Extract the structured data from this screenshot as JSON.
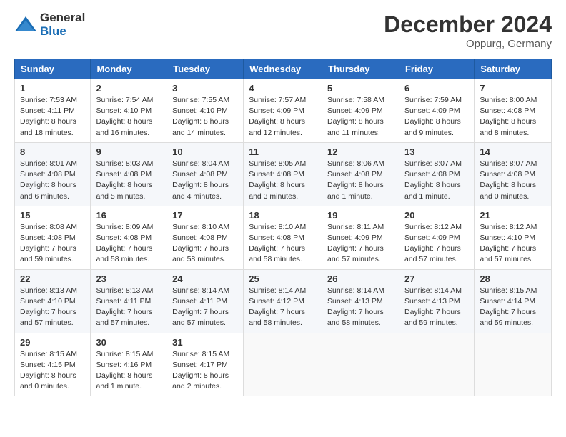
{
  "header": {
    "logo_general": "General",
    "logo_blue": "Blue",
    "month_title": "December 2024",
    "location": "Oppurg, Germany"
  },
  "days_of_week": [
    "Sunday",
    "Monday",
    "Tuesday",
    "Wednesday",
    "Thursday",
    "Friday",
    "Saturday"
  ],
  "weeks": [
    [
      {
        "day": "1",
        "sunrise": "7:53 AM",
        "sunset": "4:11 PM",
        "daylight": "8 hours and 18 minutes."
      },
      {
        "day": "2",
        "sunrise": "7:54 AM",
        "sunset": "4:10 PM",
        "daylight": "8 hours and 16 minutes."
      },
      {
        "day": "3",
        "sunrise": "7:55 AM",
        "sunset": "4:10 PM",
        "daylight": "8 hours and 14 minutes."
      },
      {
        "day": "4",
        "sunrise": "7:57 AM",
        "sunset": "4:09 PM",
        "daylight": "8 hours and 12 minutes."
      },
      {
        "day": "5",
        "sunrise": "7:58 AM",
        "sunset": "4:09 PM",
        "daylight": "8 hours and 11 minutes."
      },
      {
        "day": "6",
        "sunrise": "7:59 AM",
        "sunset": "4:09 PM",
        "daylight": "8 hours and 9 minutes."
      },
      {
        "day": "7",
        "sunrise": "8:00 AM",
        "sunset": "4:08 PM",
        "daylight": "8 hours and 8 minutes."
      }
    ],
    [
      {
        "day": "8",
        "sunrise": "8:01 AM",
        "sunset": "4:08 PM",
        "daylight": "8 hours and 6 minutes."
      },
      {
        "day": "9",
        "sunrise": "8:03 AM",
        "sunset": "4:08 PM",
        "daylight": "8 hours and 5 minutes."
      },
      {
        "day": "10",
        "sunrise": "8:04 AM",
        "sunset": "4:08 PM",
        "daylight": "8 hours and 4 minutes."
      },
      {
        "day": "11",
        "sunrise": "8:05 AM",
        "sunset": "4:08 PM",
        "daylight": "8 hours and 3 minutes."
      },
      {
        "day": "12",
        "sunrise": "8:06 AM",
        "sunset": "4:08 PM",
        "daylight": "8 hours and 1 minute."
      },
      {
        "day": "13",
        "sunrise": "8:07 AM",
        "sunset": "4:08 PM",
        "daylight": "8 hours and 1 minute."
      },
      {
        "day": "14",
        "sunrise": "8:07 AM",
        "sunset": "4:08 PM",
        "daylight": "8 hours and 0 minutes."
      }
    ],
    [
      {
        "day": "15",
        "sunrise": "8:08 AM",
        "sunset": "4:08 PM",
        "daylight": "7 hours and 59 minutes."
      },
      {
        "day": "16",
        "sunrise": "8:09 AM",
        "sunset": "4:08 PM",
        "daylight": "7 hours and 58 minutes."
      },
      {
        "day": "17",
        "sunrise": "8:10 AM",
        "sunset": "4:08 PM",
        "daylight": "7 hours and 58 minutes."
      },
      {
        "day": "18",
        "sunrise": "8:10 AM",
        "sunset": "4:08 PM",
        "daylight": "7 hours and 58 minutes."
      },
      {
        "day": "19",
        "sunrise": "8:11 AM",
        "sunset": "4:09 PM",
        "daylight": "7 hours and 57 minutes."
      },
      {
        "day": "20",
        "sunrise": "8:12 AM",
        "sunset": "4:09 PM",
        "daylight": "7 hours and 57 minutes."
      },
      {
        "day": "21",
        "sunrise": "8:12 AM",
        "sunset": "4:10 PM",
        "daylight": "7 hours and 57 minutes."
      }
    ],
    [
      {
        "day": "22",
        "sunrise": "8:13 AM",
        "sunset": "4:10 PM",
        "daylight": "7 hours and 57 minutes."
      },
      {
        "day": "23",
        "sunrise": "8:13 AM",
        "sunset": "4:11 PM",
        "daylight": "7 hours and 57 minutes."
      },
      {
        "day": "24",
        "sunrise": "8:14 AM",
        "sunset": "4:11 PM",
        "daylight": "7 hours and 57 minutes."
      },
      {
        "day": "25",
        "sunrise": "8:14 AM",
        "sunset": "4:12 PM",
        "daylight": "7 hours and 58 minutes."
      },
      {
        "day": "26",
        "sunrise": "8:14 AM",
        "sunset": "4:13 PM",
        "daylight": "7 hours and 58 minutes."
      },
      {
        "day": "27",
        "sunrise": "8:14 AM",
        "sunset": "4:13 PM",
        "daylight": "7 hours and 59 minutes."
      },
      {
        "day": "28",
        "sunrise": "8:15 AM",
        "sunset": "4:14 PM",
        "daylight": "7 hours and 59 minutes."
      }
    ],
    [
      {
        "day": "29",
        "sunrise": "8:15 AM",
        "sunset": "4:15 PM",
        "daylight": "8 hours and 0 minutes."
      },
      {
        "day": "30",
        "sunrise": "8:15 AM",
        "sunset": "4:16 PM",
        "daylight": "8 hours and 1 minute."
      },
      {
        "day": "31",
        "sunrise": "8:15 AM",
        "sunset": "4:17 PM",
        "daylight": "8 hours and 2 minutes."
      },
      null,
      null,
      null,
      null
    ]
  ],
  "labels": {
    "sunrise": "Sunrise:",
    "sunset": "Sunset:",
    "daylight": "Daylight:"
  }
}
